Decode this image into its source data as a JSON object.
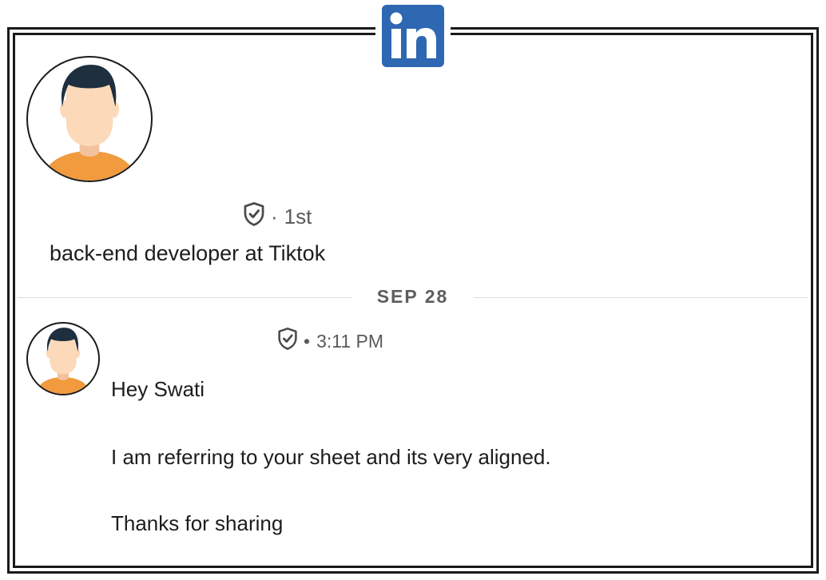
{
  "brand": {
    "logo_text": "in",
    "logo_color": "#2e67b2"
  },
  "profile": {
    "connection_degree": "1st",
    "separator": "·",
    "headline": "back-end developer at Tiktok"
  },
  "divider": {
    "date": "SEP 28"
  },
  "message": {
    "separator": "•",
    "time": "3:11 PM",
    "lines": [
      "Hey Swati",
      "I am referring to your sheet and its very aligned.",
      "Thanks for sharing"
    ]
  },
  "icons": {
    "verified": "verified-shield-icon",
    "avatar": "user-avatar-icon"
  },
  "colors": {
    "avatar_shirt": "#f19a3e",
    "avatar_skin": "#fcd9b8",
    "avatar_hair": "#1e2f3f"
  }
}
